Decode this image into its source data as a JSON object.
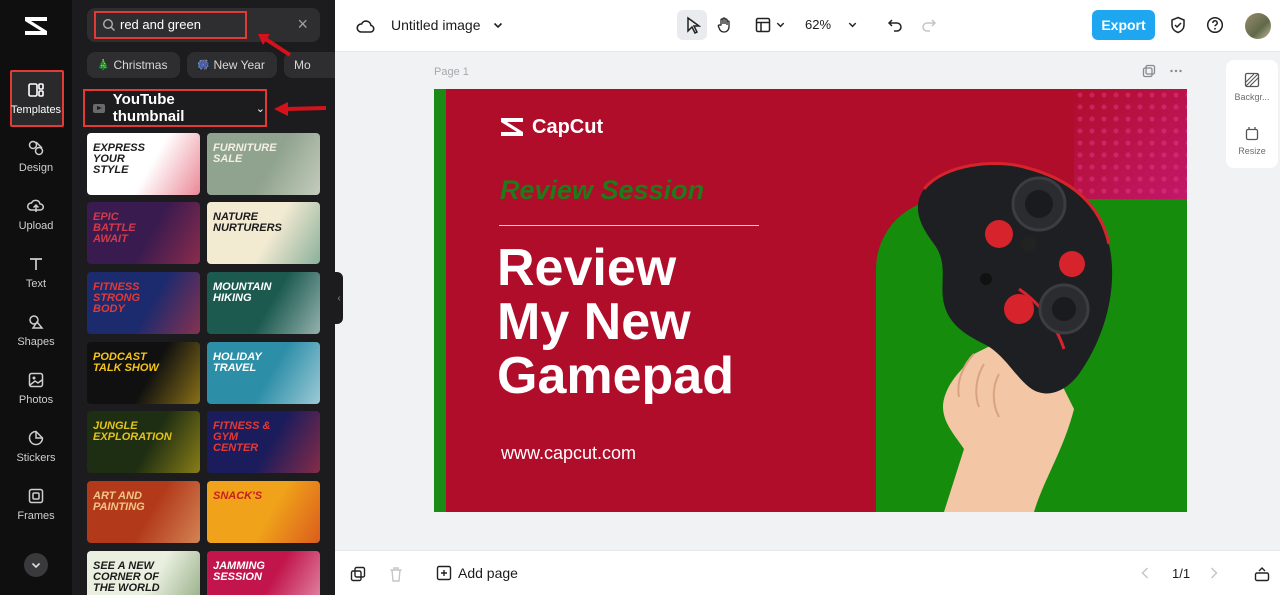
{
  "rail": {
    "items": [
      {
        "label": "Templates"
      },
      {
        "label": "Design"
      },
      {
        "label": "Upload"
      },
      {
        "label": "Text"
      },
      {
        "label": "Shapes"
      },
      {
        "label": "Photos"
      },
      {
        "label": "Stickers"
      },
      {
        "label": "Frames"
      }
    ]
  },
  "panel": {
    "search": {
      "query": "red and green",
      "clear": "×"
    },
    "chips": [
      {
        "emoji": "🎄",
        "label": "Christmas"
      },
      {
        "emoji": "🎆",
        "label": "New Year"
      },
      {
        "emoji": "",
        "label": "Mo"
      }
    ],
    "category": {
      "label": "YouTube thumbnail"
    },
    "templates": [
      {
        "text": "EXPRESS YOUR STYLE",
        "bg": "#ffffff",
        "accent": "#d81f3a"
      },
      {
        "text": "FURNITURE SALE",
        "bg": "#8fa38e",
        "accent": "#f4efe6"
      },
      {
        "text": "EPIC BATTLE AWAIT",
        "bg": "#3a1b4f",
        "accent": "#d33a4a"
      },
      {
        "text": "Nature Nurturers",
        "bg": "#f3ead2",
        "accent": "#2f7d6a"
      },
      {
        "text": "FITNESS STRONG BODY",
        "bg": "#1c2a6e",
        "accent": "#e53935"
      },
      {
        "text": "MOUNTAIN HIKING",
        "bg": "#1c5a50",
        "accent": "#ffffff"
      },
      {
        "text": "Podcast Talk Show",
        "bg": "#101010",
        "accent": "#f4c51c"
      },
      {
        "text": "HOLIDAY TRAVEL",
        "bg": "#2d8ea8",
        "accent": "#ffffff"
      },
      {
        "text": "JUNGLE EXPLORATION",
        "bg": "#1e2e12",
        "accent": "#e7c31a"
      },
      {
        "text": "FITNESS & GYM CENTER",
        "bg": "#1b1c5c",
        "accent": "#e53935"
      },
      {
        "text": "ART AND PAINTING",
        "bg": "#b23a1a",
        "accent": "#f2c48a"
      },
      {
        "text": "SNACK'S",
        "bg": "#f0a21a",
        "accent": "#c81e1e"
      },
      {
        "text": "SEE A NEW CORNER OF THE WORLD",
        "bg": "#eaf0e0",
        "accent": "#3f6a2a"
      },
      {
        "text": "JAMMING SESSION",
        "bg": "#c2154c",
        "accent": "#ffffff"
      }
    ]
  },
  "topbar": {
    "title": "Untitled image",
    "zoom": "62%",
    "export_label": "Export"
  },
  "canvas": {
    "page_label": "Page 1",
    "brand": "CapCut",
    "subtitle": "Review Session",
    "headline": [
      "Review",
      "My New",
      "Gamepad"
    ],
    "url": "www.capcut.com",
    "colors": {
      "red": "#b00d2a",
      "green": "#168c0c"
    }
  },
  "side_panel": {
    "items": [
      {
        "label": "Backgr..."
      },
      {
        "label": "Resize"
      }
    ]
  },
  "bottombar": {
    "add_page": "Add page",
    "pager": "1/1"
  },
  "colors": {
    "accent": "#1fa6f0",
    "highlight": "#e53935"
  }
}
